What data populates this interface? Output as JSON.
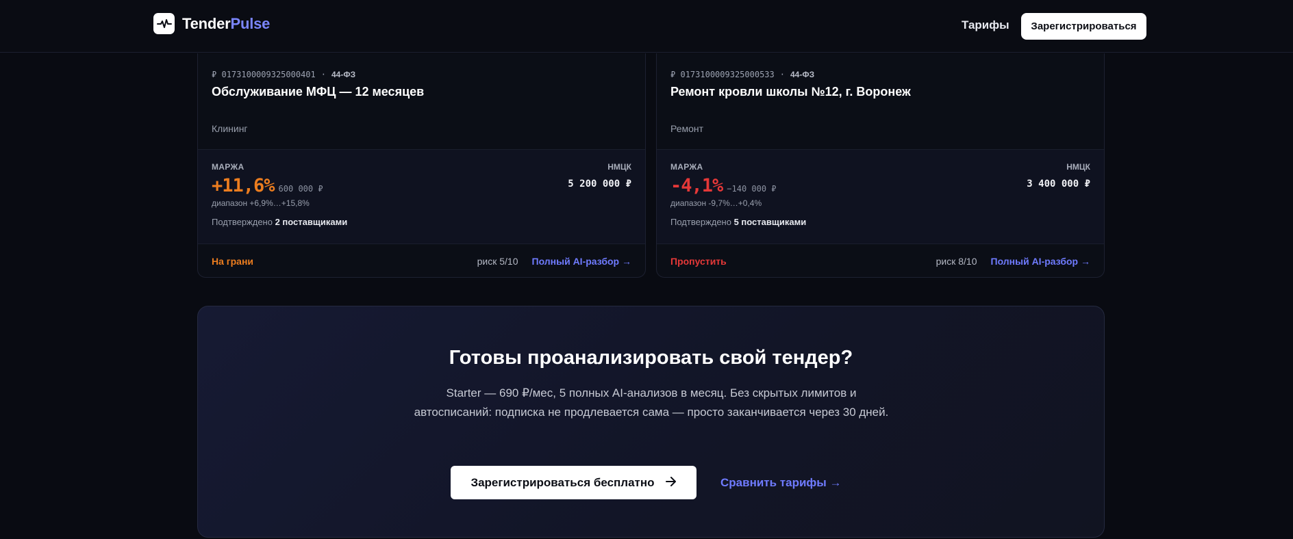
{
  "header": {
    "logo_text_a": "Tender",
    "logo_text_b": "Pulse",
    "nav_tariffs": "Тарифы",
    "register_label": "Зарегистрироваться",
    "brand_accent": "#7b86ff"
  },
  "cards": [
    {
      "id_prefix": "₽",
      "tender_number": "0173100009325000401",
      "separator": "·",
      "law": "44-ФЗ",
      "title": "Обслуживание МФЦ — 12 месяцев",
      "category": "Клининг",
      "margin_label": "МАРЖА",
      "margin_value": "+11,6%",
      "margin_abs": "600 000 ₽",
      "range": "диапазон +6,9%…+15,8%",
      "confirmed_prefix": "Подтверждено",
      "confirmed_count": "2 поставщиками",
      "nmck_label": "НМЦК",
      "nmck_value": "5 200 000 ₽",
      "verdict": "На грани",
      "verdict_color": "#ec7d1f",
      "risk": "риск 5/10",
      "ai_link": "Полный AI-разбор →"
    },
    {
      "id_prefix": "₽",
      "tender_number": "0173100009325000533",
      "separator": "·",
      "law": "44-ФЗ",
      "title": "Ремонт кровли школы №12, г. Воронеж",
      "category": "Ремонт",
      "margin_label": "МАРЖА",
      "margin_value": "-4,1%",
      "margin_abs": "−140 000 ₽",
      "range": "диапазон -9,7%…+0,4%",
      "confirmed_prefix": "Подтверждено",
      "confirmed_count": "5 поставщиками",
      "nmck_label": "НМЦК",
      "nmck_value": "3 400 000 ₽",
      "verdict": "Пропустить",
      "verdict_color": "#e53838",
      "risk": "риск 8/10",
      "ai_link": "Полный AI-разбор →"
    }
  ],
  "cta": {
    "title": "Готовы проанализировать свой тендер?",
    "description": "Starter — 690 ₽/мес, 5 полных AI-анализов в месяц. Без скрытых лимитов и автосписаний: подписка не продлевается сама — просто заканчивается через 30 дней.",
    "primary_label": "Зарегистрироваться бесплатно",
    "primary_icon": "arrow-right-icon",
    "secondary_label": "Сравнить тарифы →"
  }
}
